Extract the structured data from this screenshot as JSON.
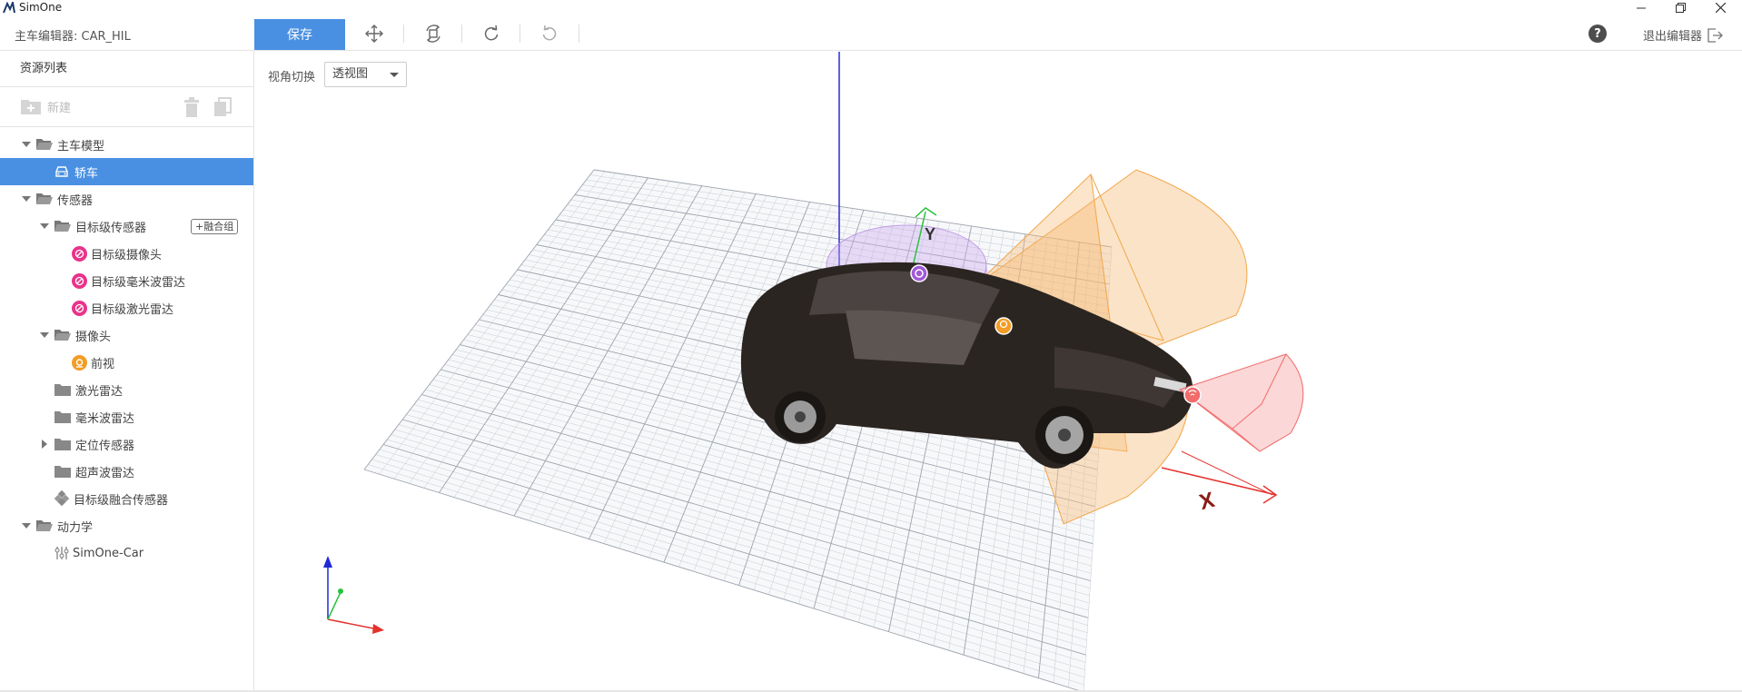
{
  "window": {
    "title": "SimOne"
  },
  "toolbar": {
    "editor_name": "主车编辑器: CAR_HIL",
    "save_label": "保存",
    "help_label": "?",
    "exit_label": "退出编辑器"
  },
  "sidebar": {
    "header": "资源列表",
    "new_label": "新建",
    "fusion_tag": "+融合组",
    "items": [
      {
        "label": "主车模型"
      },
      {
        "label": "轿车"
      },
      {
        "label": "传感器"
      },
      {
        "label": "目标级传感器"
      },
      {
        "label": "目标级摄像头"
      },
      {
        "label": "目标级毫米波雷达"
      },
      {
        "label": "目标级激光雷达"
      },
      {
        "label": "摄像头"
      },
      {
        "label": "前视"
      },
      {
        "label": "激光雷达"
      },
      {
        "label": "毫米波雷达"
      },
      {
        "label": "定位传感器"
      },
      {
        "label": "超声波雷达"
      },
      {
        "label": "目标级融合传感器"
      },
      {
        "label": "动力学"
      },
      {
        "label": "SimOne-Car"
      }
    ]
  },
  "viewport": {
    "view_label": "视角切换",
    "view_value": "透视图",
    "axis_y": "Y",
    "axis_x": "X"
  },
  "colors": {
    "accent": "#4a90e2",
    "sensor_pink": "#e8348a",
    "sensor_orange": "#f39c26",
    "sensor_purple": "#a259d9",
    "radar_red": "#f26b6b"
  }
}
